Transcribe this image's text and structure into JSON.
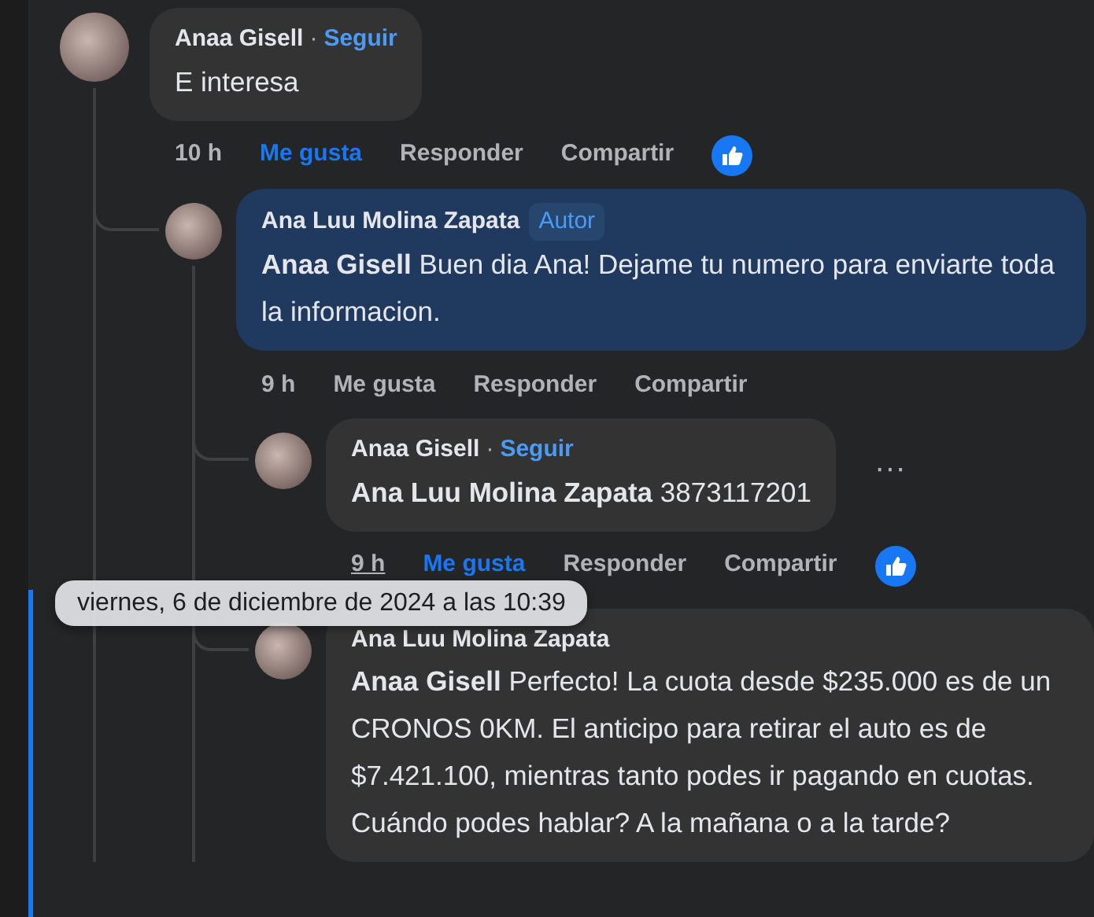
{
  "comments": [
    {
      "author": "Anaa Gisell",
      "separator": "·",
      "follow": "Seguir",
      "author_bubble": false,
      "body": "E interesa",
      "time": "10 h",
      "time_hovered": false,
      "actions": [
        "Me gusta",
        "Responder",
        "Compartir"
      ],
      "liked": true,
      "children": [
        {
          "author": "Ana Luu Molina Zapata",
          "badge": "Autor",
          "author_bubble": true,
          "body": "**Anaa Gisell** Buen dia Ana! Dejame tu numero para enviarte toda la informacion.",
          "time": "9 h",
          "time_hovered": false,
          "actions": [
            "Me gusta",
            "Responder",
            "Compartir"
          ],
          "liked": false,
          "children": [
            {
              "author": "Anaa Gisell",
              "separator": "·",
              "follow": "Seguir",
              "author_bubble": false,
              "body": "**Ana Luu Molina Zapata** 3873117201",
              "more": "···",
              "time": "9 h",
              "time_hovered": true,
              "actions": [
                "Me gusta",
                "Responder",
                "Compartir"
              ],
              "liked": true
            },
            {
              "author": "Ana Luu Molina Zapata",
              "author_bubble": false,
              "body": "**Anaa Gisell** Perfecto! La cuota desde $235.000 es de un CRONOS 0KM. El anticipo para retirar el auto es de $7.421.100, mientras tanto podes ir pagando en cuotas. Cuándo podes hablar? A la mañana o a la tarde?",
              "highlighted": true
            }
          ]
        }
      ]
    }
  ],
  "tooltip": "viernes, 6 de diciembre de 2024 a las 10:39"
}
